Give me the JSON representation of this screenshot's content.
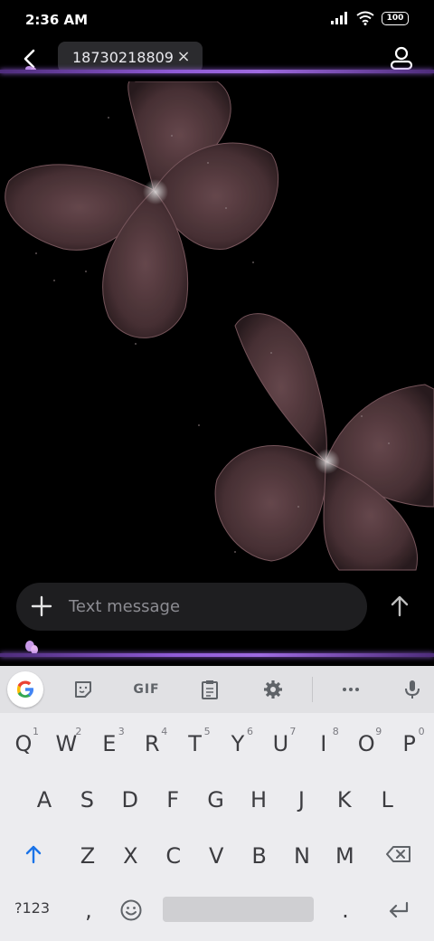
{
  "status_bar": {
    "time": "2:36 AM",
    "battery": "100"
  },
  "header": {
    "recipient": "18730218809",
    "remove_label": "×"
  },
  "compose": {
    "placeholder": "Text message"
  },
  "keyboard": {
    "row1": [
      {
        "key": "Q",
        "hint": "1"
      },
      {
        "key": "W",
        "hint": "2"
      },
      {
        "key": "E",
        "hint": "3"
      },
      {
        "key": "R",
        "hint": "4"
      },
      {
        "key": "T",
        "hint": "5"
      },
      {
        "key": "Y",
        "hint": "6"
      },
      {
        "key": "U",
        "hint": "7"
      },
      {
        "key": "I",
        "hint": "8"
      },
      {
        "key": "O",
        "hint": "9"
      },
      {
        "key": "P",
        "hint": "0"
      }
    ],
    "row2": [
      "A",
      "S",
      "D",
      "F",
      "G",
      "H",
      "J",
      "K",
      "L"
    ],
    "row3": [
      "Z",
      "X",
      "C",
      "V",
      "B",
      "N",
      "M"
    ],
    "bottom": {
      "symbols": "?123",
      "comma": ",",
      "period": "."
    },
    "toolbar": {
      "gif": "GIF"
    }
  },
  "icons": [
    "back-arrow-icon",
    "contact-icon",
    "plus-icon",
    "send-arrow-icon",
    "google-icon",
    "sticker-icon",
    "clipboard-icon",
    "settings-icon",
    "more-icon",
    "mic-icon",
    "shift-icon",
    "backspace-icon",
    "emoji-icon",
    "enter-icon"
  ],
  "colors": {
    "accent_line": "#8f5bd6",
    "keyboard_bg": "#ececef",
    "compose_bg": "#1e1e20"
  }
}
